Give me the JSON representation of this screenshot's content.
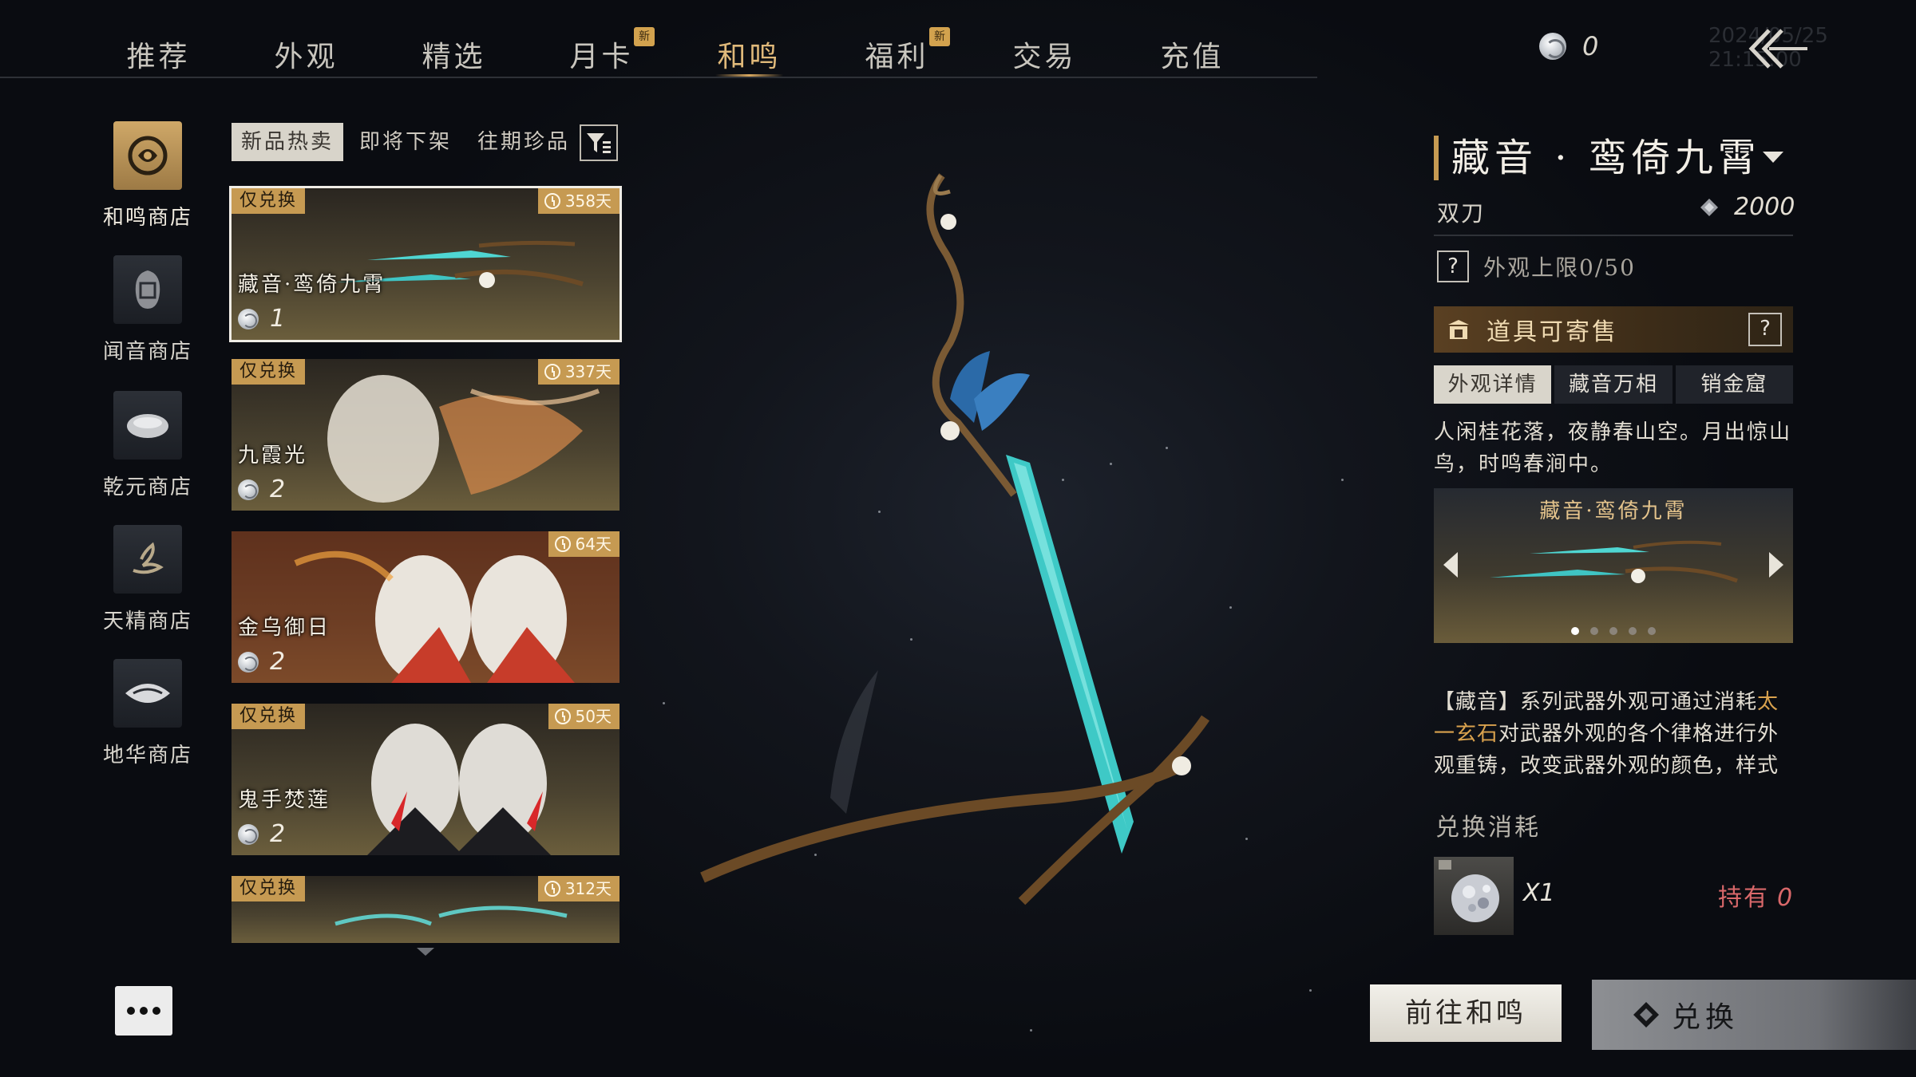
{
  "nav": {
    "tabs": [
      {
        "label": "推荐",
        "badge": ""
      },
      {
        "label": "外观",
        "badge": ""
      },
      {
        "label": "精选",
        "badge": ""
      },
      {
        "label": "月卡",
        "badge": "新"
      },
      {
        "label": "和鸣",
        "badge": ""
      },
      {
        "label": "福利",
        "badge": "新"
      },
      {
        "label": "交易",
        "badge": ""
      },
      {
        "label": "充值",
        "badge": ""
      }
    ],
    "active_tab": "和鸣",
    "currency": "0",
    "timestamp_watermark": "2024/05/25 21:15:00"
  },
  "sidebar": {
    "shops": [
      {
        "label": "和鸣商店",
        "icon": "hemin-shop-icon",
        "active": true
      },
      {
        "label": "闻音商店",
        "icon": "wenyin-shop-icon",
        "active": false
      },
      {
        "label": "乾元商店",
        "icon": "qianyuan-shop-icon",
        "active": false
      },
      {
        "label": "天精商店",
        "icon": "tianjing-shop-icon",
        "active": false
      },
      {
        "label": "地华商店",
        "icon": "dihua-shop-icon",
        "active": false
      }
    ]
  },
  "sub_tabs": [
    {
      "label": "新品热卖",
      "active": true
    },
    {
      "label": "即将下架",
      "active": false
    },
    {
      "label": "往期珍品",
      "active": false
    }
  ],
  "items": [
    {
      "name": "藏音·鸾倚九霄",
      "tag": "仅兑换",
      "days": "358天",
      "price": "1",
      "selected": true
    },
    {
      "name": "九霞光",
      "tag": "仅兑换",
      "days": "337天",
      "price": "2",
      "selected": false
    },
    {
      "name": "金乌御日",
      "tag": "",
      "days": "64天",
      "price": "2",
      "selected": false
    },
    {
      "name": "鬼手焚莲",
      "tag": "仅兑换",
      "days": "50天",
      "price": "2",
      "selected": false
    },
    {
      "name": "",
      "tag": "仅兑换",
      "days": "312天",
      "price": "",
      "selected": false
    }
  ],
  "detail": {
    "title": "藏音 · 鸾倚九霄",
    "weapon_type": "双刀",
    "price": "2000",
    "appearance_limit": "外观上限0/50",
    "tradeable": "道具可寄售",
    "tabs": [
      {
        "label": "外观详情",
        "active": true
      },
      {
        "label": "藏音万相",
        "active": false
      },
      {
        "label": "销金窟",
        "active": false
      }
    ],
    "flavor": "人闲桂花落，夜静春山空。月出惊山鸟，时鸣春涧中。",
    "preview_title": "藏音·鸾倚九霄",
    "preview_page_count": 5,
    "preview_page_current": 1,
    "description_parts": {
      "pre": "【藏音】系列武器外观可通过消耗",
      "highlight": "太一玄石",
      "post": "对武器外观的各个律格进行外观重铸，改变武器外观的颜色，样式"
    },
    "cost_label": "兑换消耗",
    "cost_qty": "X1",
    "owned_label": "持有",
    "owned_value": "0"
  },
  "buttons": {
    "goto": "前往和鸣",
    "exchange": "兑换"
  },
  "colors": {
    "accent_gold": "#c69a52",
    "active_tab": "#e0b97a",
    "warning_red": "#d9686a",
    "highlight_text": "#d9a24e"
  }
}
